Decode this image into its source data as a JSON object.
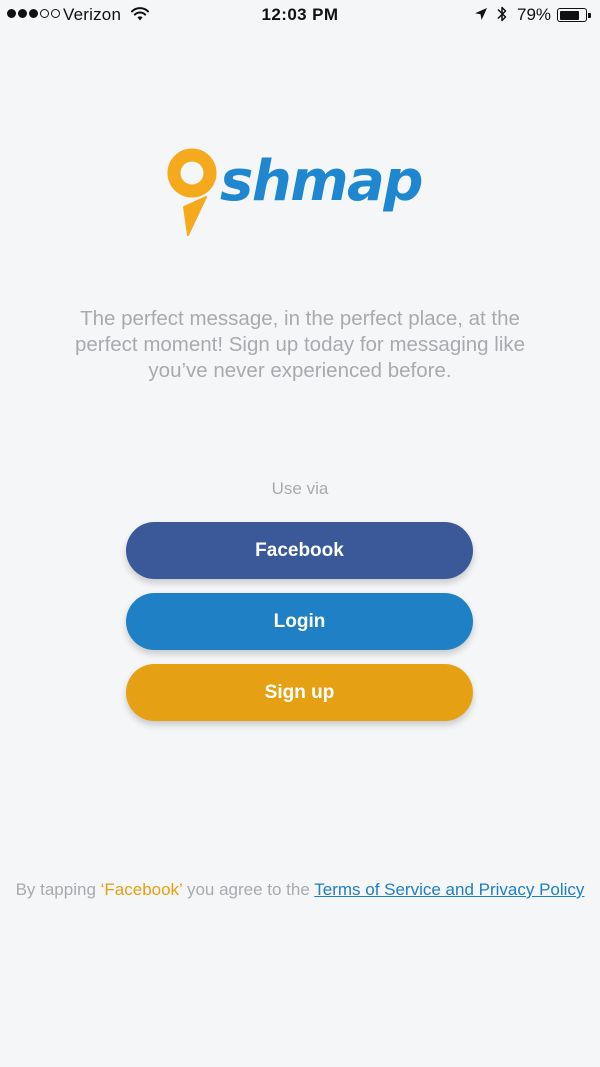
{
  "status_bar": {
    "signal_bars_filled": 3,
    "signal_bars_total": 5,
    "carrier": "Verizon",
    "time": "12:03 PM",
    "battery_percent_label": "79%",
    "battery_level": 0.79,
    "icons": [
      "wifi-icon",
      "location-icon",
      "bluetooth-icon",
      "battery-icon"
    ]
  },
  "logo": {
    "text": "shmap",
    "pin_color": "#f5a91c",
    "text_color": "#1f87cf"
  },
  "tagline": "The perfect message, in the perfect place, at the perfect moment! Sign up today for messaging like you’ve never experienced before.",
  "use_via_label": "Use via",
  "buttons": {
    "facebook": "Facebook",
    "login": "Login",
    "signup": "Sign up"
  },
  "terms": {
    "prefix": "By tapping ",
    "highlight": "‘Facebook’",
    "middle": " you agree to the ",
    "link": "Terms of Service and Privacy Policy"
  },
  "colors": {
    "background": "#f5f6f8",
    "facebook": "#3b5998",
    "login": "#1f80c6",
    "signup": "#e5a013",
    "muted_text": "#a8aaae",
    "link": "#1f7ec6"
  }
}
